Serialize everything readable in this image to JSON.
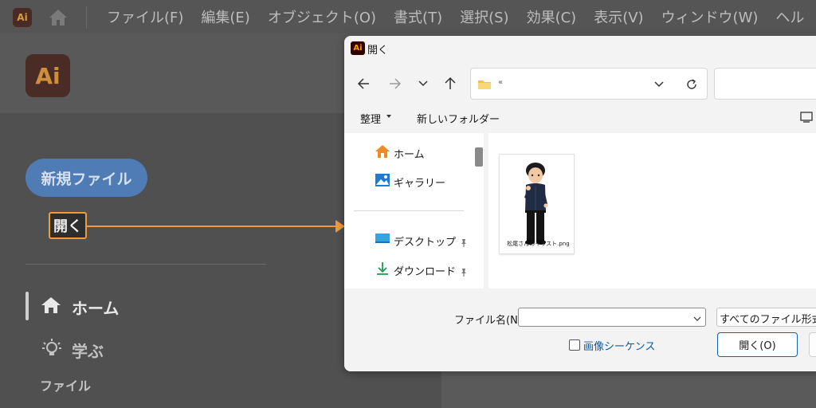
{
  "illustrator": {
    "app_icon": "Ai",
    "menu": [
      "ファイル(F)",
      "編集(E)",
      "オブジェクト(O)",
      "書式(T)",
      "選択(S)",
      "効果(C)",
      "表示(V)",
      "ウィンドウ(W)",
      "ヘル"
    ],
    "logo": "Ai",
    "new_file": "新規ファイル",
    "open": "開く",
    "nav": {
      "home": "ホーム",
      "learn": "学ぶ",
      "files": "ファイル"
    },
    "highlight_color": "#f09a3c"
  },
  "dialog": {
    "app_icon": "Ai",
    "title": "開く",
    "address_path": "«",
    "command_bar": {
      "organize": "整理",
      "new_folder": "新しいフォルダー"
    },
    "nav_pane": [
      {
        "label": "ホーム",
        "icon": "home-icon"
      },
      {
        "label": "ギャラリー",
        "icon": "gallery-icon"
      },
      {
        "label": "デスクトップ",
        "icon": "desktop-icon",
        "pinned": true
      },
      {
        "label": "ダウンロード",
        "icon": "download-icon",
        "pinned": true
      }
    ],
    "files": [
      {
        "name": "松尾さんのイラスト.png",
        "icon": "character-illustration-thumbnail"
      }
    ],
    "footer": {
      "file_name_label": "ファイル名(N):",
      "file_name_value": "",
      "file_type": "すべてのファイル形式 (",
      "image_sequence": "画像シーケンス",
      "open_button": "開く(O)"
    }
  }
}
